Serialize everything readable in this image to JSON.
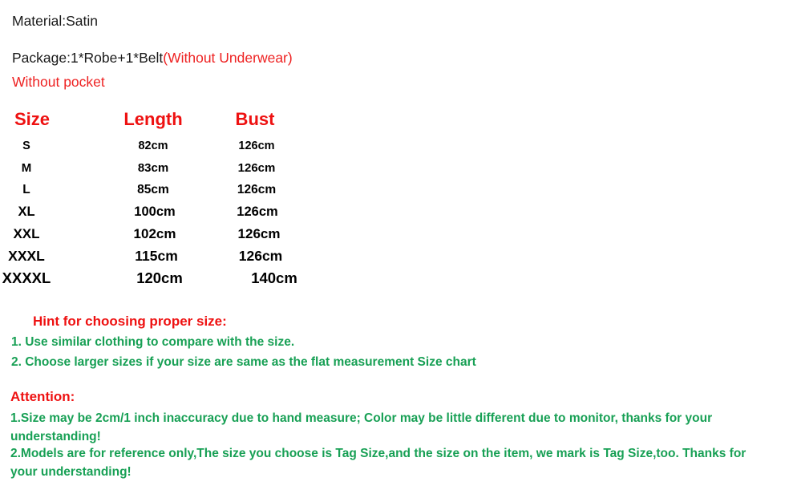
{
  "product_info": {
    "material_line": "Material:Satin",
    "package_label": "Package:1*Robe+1*Belt",
    "package_note": "(Without Underwear)",
    "pocket_note": "Without pocket"
  },
  "size_chart": {
    "headers": {
      "size": "Size",
      "length": "Length",
      "bust": "Bust"
    },
    "rows": [
      {
        "size": "S",
        "length": "82cm",
        "bust": "126cm"
      },
      {
        "size": "M",
        "length": "83cm",
        "bust": "126cm"
      },
      {
        "size": "L",
        "length": "85cm",
        "bust": "126cm"
      },
      {
        "size": "XL",
        "length": "100cm",
        "bust": "126cm"
      },
      {
        "size": "XXL",
        "length": "102cm",
        "bust": "126cm"
      },
      {
        "size": "XXXL",
        "length": "115cm",
        "bust": "126cm"
      },
      {
        "size": "XXXXL",
        "length": "120cm",
        "bust": "140cm"
      }
    ]
  },
  "hint": {
    "title": "Hint for choosing proper size:",
    "items": [
      "1. Use similar clothing to compare with the size.",
      "2. Choose larger sizes if your size are same as the flat measurement Size chart"
    ]
  },
  "attention": {
    "title": "Attention:",
    "items": [
      "1.Size may be 2cm/1 inch inaccuracy due to hand measure; Color may be little different   due to monitor, thanks for your understanding!",
      "2.Models are for reference only,The size you choose is Tag Size,and the size on the item,  we mark is Tag Size,too. Thanks for your understanding!"
    ]
  },
  "colors": {
    "red": "#ee1111",
    "green": "#18a055",
    "black": "#000000",
    "background": "#ffffff"
  }
}
